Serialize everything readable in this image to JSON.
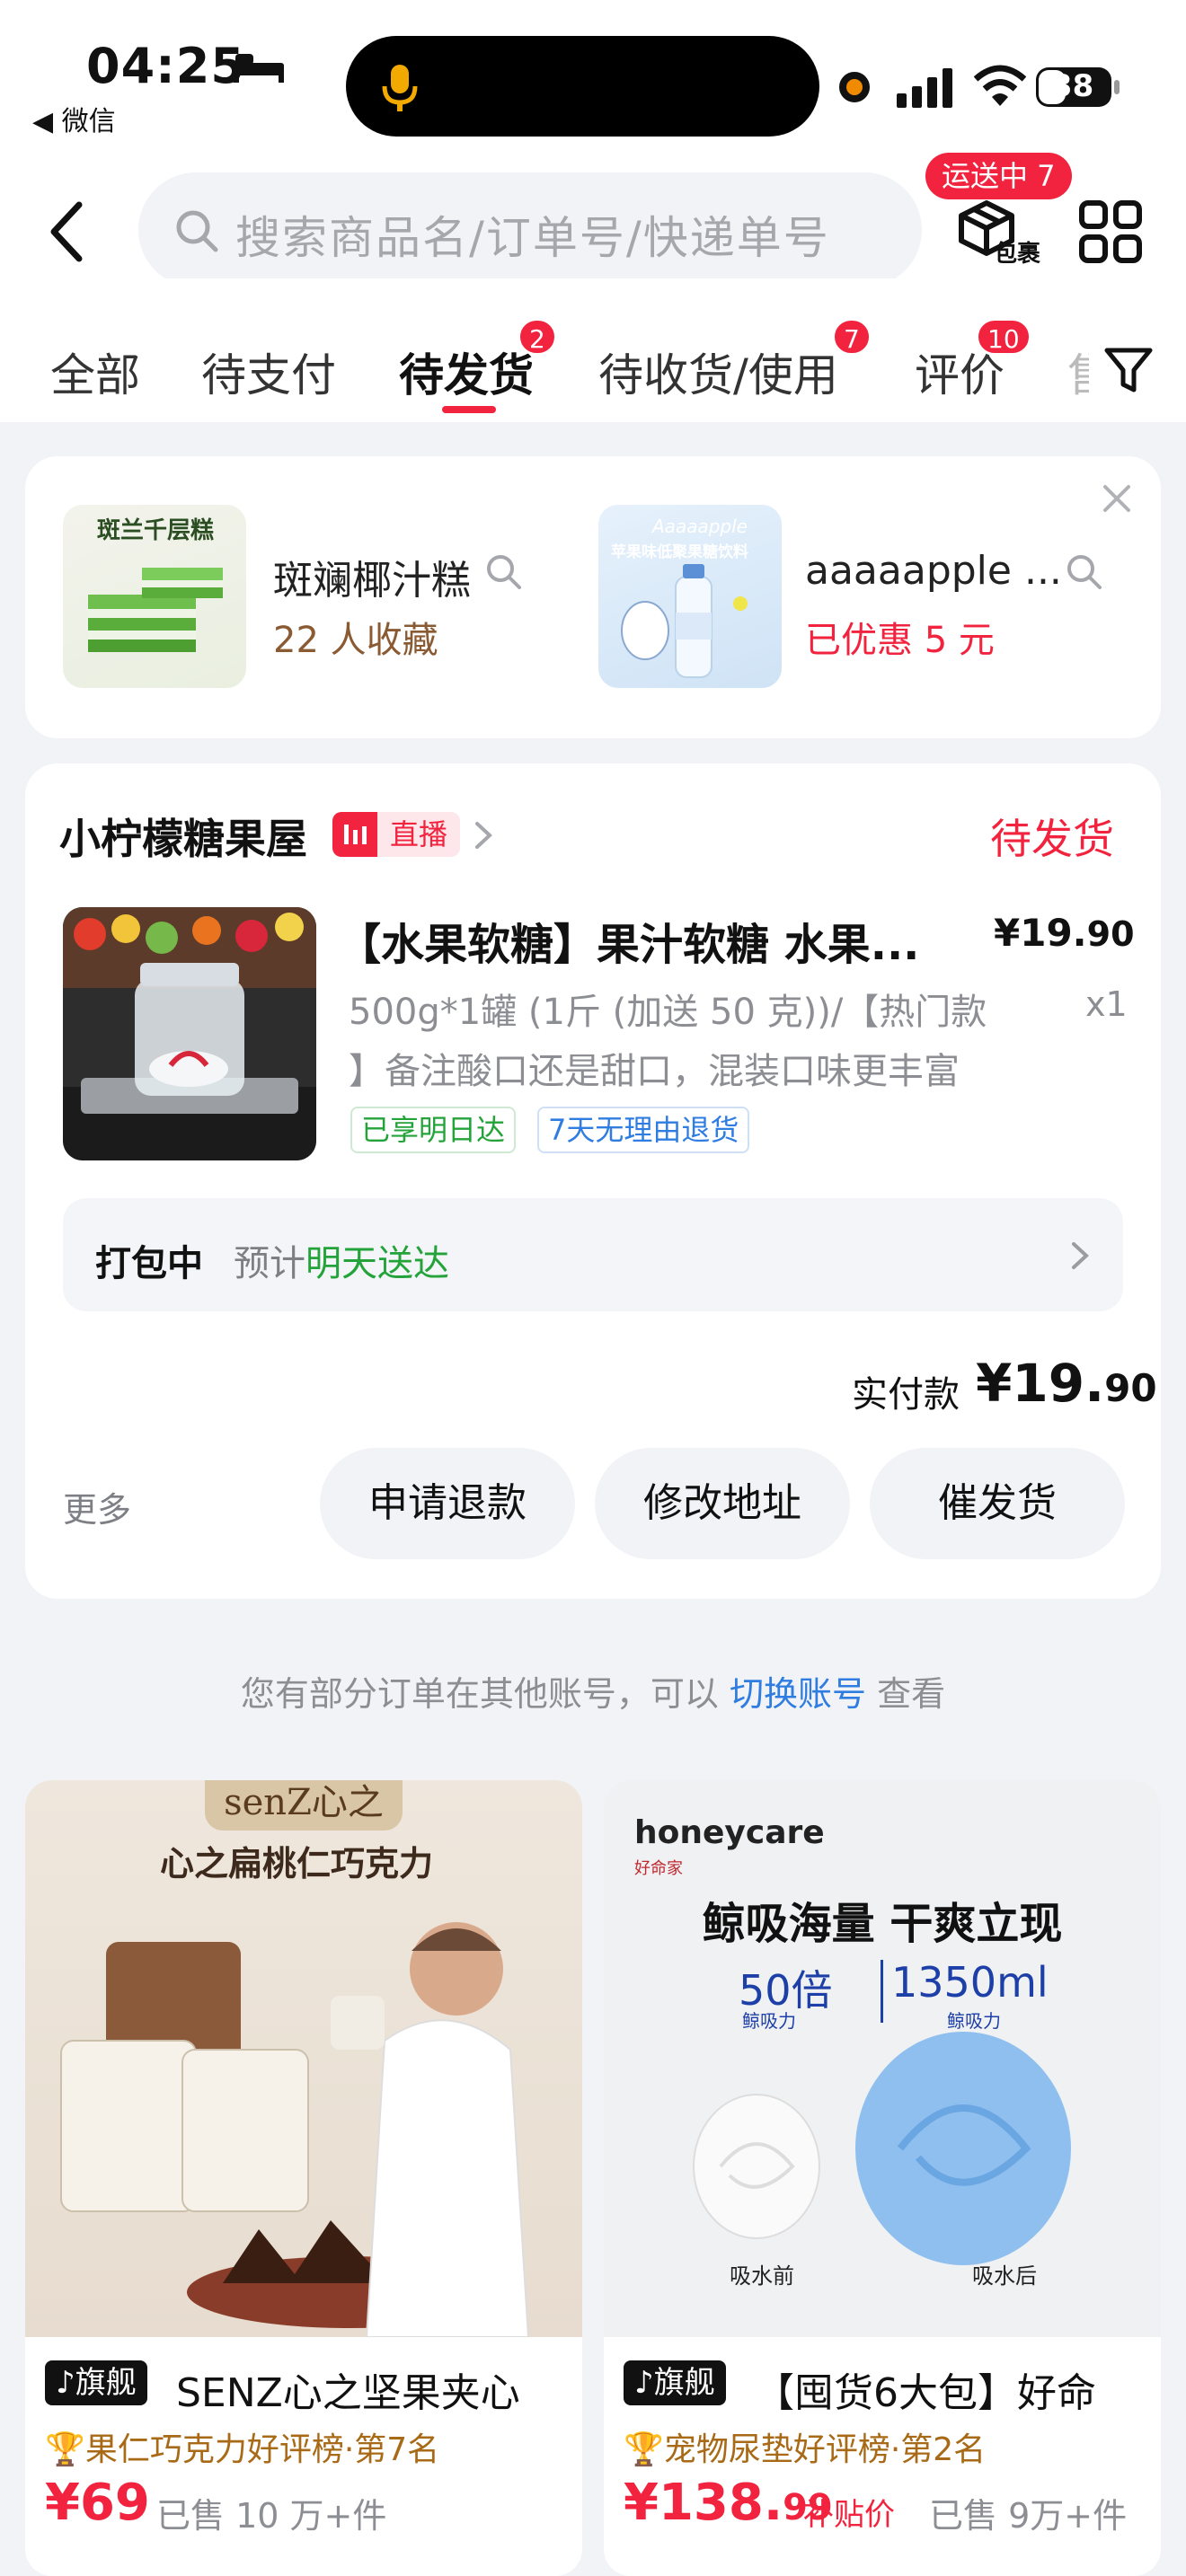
{
  "status_bar": {
    "time": "04:25",
    "back_app": "◀ 微信",
    "battery": "38"
  },
  "header": {
    "search_placeholder": "搜索商品名/订单号/快递单号",
    "package_badge": "运送中 7",
    "package_label": "包裹"
  },
  "tabs": [
    {
      "label": "全部"
    },
    {
      "label": "待支付"
    },
    {
      "label": "待发货",
      "badge": "2",
      "active": true
    },
    {
      "label": "待收货/使用",
      "badge": "7"
    },
    {
      "label": "评价",
      "badge": "10"
    },
    {
      "label": "售"
    }
  ],
  "recommendations": [
    {
      "name": "斑斓椰汁糕",
      "sub": "22 人收藏",
      "thumb_text": "斑兰千层糕"
    },
    {
      "name": "aaaaapple ...",
      "sub": "已优惠 5 元",
      "thumb_text": "苹果味低聚果糖饮料",
      "thumb_brand": "Aaaaapple"
    }
  ],
  "order": {
    "shop_name": "小柠檬糖果屋",
    "live_tag": "直播",
    "status": "待发货",
    "product_title": "【水果软糖】果汁软糖 水果...",
    "price_main": "¥19.",
    "price_decimal": "90",
    "spec_line1": "500g*1罐 (1斤 (加送 50 克))/【热门款",
    "spec_line2": "】备注酸口还是甜口，混装口味更丰富",
    "quantity": "x1",
    "tags": [
      "已享明日达",
      "7天无理由退货"
    ],
    "progress_label": "打包中",
    "progress_est": "预计",
    "progress_date": "明天送达",
    "pay_label": "实付款",
    "pay_main": "¥19.",
    "pay_decimal": "90",
    "more": "更多",
    "buttons": [
      "申请退款",
      "修改地址",
      "催发货"
    ]
  },
  "notice": {
    "text_before": "您有部分订单在其他账号，可以 ",
    "link": "切换账号",
    "text_after": " 查看"
  },
  "feed": [
    {
      "img_brand": "senZ心之",
      "img_title": "心之扁桃仁巧克力",
      "flag": "旗舰",
      "title": "SENZ心之坚果夹心",
      "rank": "果仁巧克力好评榜·第7名",
      "price_main": "¥69",
      "price_decimal": "",
      "price_note": "",
      "sold": "已售 10 万+件"
    },
    {
      "img_brand": "honeycare",
      "img_brand_sub": "好命家",
      "img_headline": "鲸吸海量 干爽立现",
      "img_stat1": "50倍",
      "img_stat1_sub": "鲸吸力",
      "img_stat2": "1350ml",
      "img_stat2_sub": "鲸吸力",
      "img_before": "吸水前",
      "img_after": "吸水后",
      "flag": "旗舰",
      "title": "【囤货6大包】好命",
      "rank": "宠物尿垫好评榜·第2名",
      "price_main": "¥138.",
      "price_decimal": "99",
      "price_note": "补贴价",
      "sold": "已售 9万+件"
    }
  ],
  "colors": {
    "accent": "#f1233e",
    "green": "#23a33a",
    "blue": "#2f7de0",
    "background": "#f2f3f7"
  }
}
